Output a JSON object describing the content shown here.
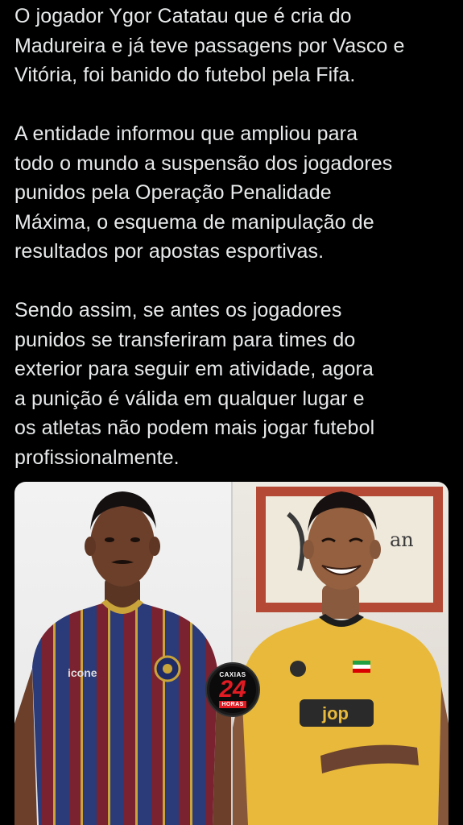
{
  "post": {
    "paragraphs": [
      {
        "lines": [
          "O jogador Ygor Catatau que é cria do",
          "Madureira e já teve passagens por Vasco e",
          "Vitória, foi banido do futebol pela Fifa."
        ]
      },
      {
        "lines": [
          "A entidade informou que ampliou para",
          "todo o mundo a suspensão dos jogadores",
          "punidos pela Operação Penalidade",
          "Máxima, o esquema de manipulação de",
          "resultados por apostas esportivas."
        ]
      },
      {
        "lines": [
          "Sendo assim, se antes os jogadores",
          "punidos se transferiram para times do",
          "exterior para seguir em atividade, agora",
          "a punição é válida em qualquer lugar e",
          "os atletas não podem mais jogar futebol",
          "profissionalmente."
        ]
      }
    ]
  },
  "media": {
    "left_panel": {
      "jersey_brand": "icone"
    },
    "right_panel": {
      "frame_text": "an",
      "sponsor_text": "jop"
    },
    "watermark": {
      "top": "CAXIAS",
      "number": "24",
      "bottom": "HORAS"
    }
  },
  "colors": {
    "background": "#000000",
    "text": "#e7e9ea",
    "watermark_red": "#e21b23"
  }
}
